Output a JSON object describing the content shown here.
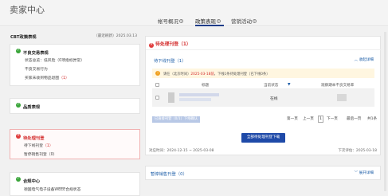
{
  "app_title": "卖家中心",
  "tabs": [
    {
      "label": "帐号概况"
    },
    {
      "label": "政策表现"
    },
    {
      "label": "营销活动"
    }
  ],
  "left": {
    "title": "CBT政策表现",
    "date": "（最近刷新）2025.03.13",
    "cards": {
      "unfair": {
        "title": "不良交易表现",
        "items": [
          {
            "text": "状态总览：低风险（0项指标异常）"
          },
          {
            "text": "不良交易行为"
          },
          {
            "text": "买家未收到物品退图",
            "count": "（1）"
          }
        ]
      },
      "quality": {
        "title": "品质表现"
      },
      "pending": {
        "title": "待处理刊登",
        "items": [
          {
            "text": "待下线刊登",
            "count": "（1）"
          },
          {
            "text": "暂停销售刊登（0）"
          }
        ]
      },
      "compliance": {
        "title": "合规中心",
        "items": [
          {
            "text": "德国电气电子设备WEEE合规状态"
          }
        ]
      }
    }
  },
  "panel": {
    "title": "待处理刊登",
    "count": "（1）",
    "section1": {
      "title": "待下线刊登（1）",
      "toggle": "收起详细"
    },
    "tip": {
      "prefix": "请在（北京时间）",
      "date": "2025-03-18前",
      "suffix": "，下线1条待处理刊登（已下线0条）"
    },
    "table": {
      "headers": [
        "标题",
        "当前状态",
        "观察期本不良交易率"
      ],
      "rows": [
        {
          "status": "在线"
        }
      ]
    },
    "bulk_button": "已直接刊登（0/1）下线确认",
    "pager": {
      "first": "第一页",
      "prev": "上一页",
      "current": "1",
      "next": "下一页",
      "last": "最后一页",
      "total": "共1条"
    },
    "primary_button": "全部待处理刊登下载",
    "period_label": "对应时间：",
    "period_value": "2024-12-15 ~ 2025-03-08",
    "deadline_label": "下次评估：",
    "deadline_value": "2025-03-18",
    "section2": {
      "title": "暂停销售刊登（0）",
      "toggle": "展开详细"
    }
  }
}
